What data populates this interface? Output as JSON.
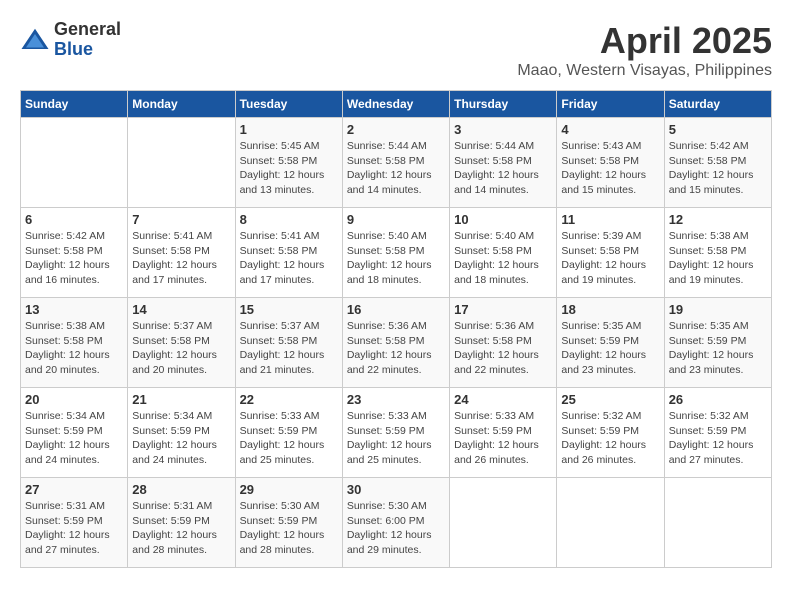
{
  "logo": {
    "general": "General",
    "blue": "Blue"
  },
  "title": "April 2025",
  "subtitle": "Maao, Western Visayas, Philippines",
  "days_of_week": [
    "Sunday",
    "Monday",
    "Tuesday",
    "Wednesday",
    "Thursday",
    "Friday",
    "Saturday"
  ],
  "weeks": [
    [
      {
        "day": "",
        "info": ""
      },
      {
        "day": "",
        "info": ""
      },
      {
        "day": "1",
        "info": "Sunrise: 5:45 AM\nSunset: 5:58 PM\nDaylight: 12 hours\nand 13 minutes."
      },
      {
        "day": "2",
        "info": "Sunrise: 5:44 AM\nSunset: 5:58 PM\nDaylight: 12 hours\nand 14 minutes."
      },
      {
        "day": "3",
        "info": "Sunrise: 5:44 AM\nSunset: 5:58 PM\nDaylight: 12 hours\nand 14 minutes."
      },
      {
        "day": "4",
        "info": "Sunrise: 5:43 AM\nSunset: 5:58 PM\nDaylight: 12 hours\nand 15 minutes."
      },
      {
        "day": "5",
        "info": "Sunrise: 5:42 AM\nSunset: 5:58 PM\nDaylight: 12 hours\nand 15 minutes."
      }
    ],
    [
      {
        "day": "6",
        "info": "Sunrise: 5:42 AM\nSunset: 5:58 PM\nDaylight: 12 hours\nand 16 minutes."
      },
      {
        "day": "7",
        "info": "Sunrise: 5:41 AM\nSunset: 5:58 PM\nDaylight: 12 hours\nand 17 minutes."
      },
      {
        "day": "8",
        "info": "Sunrise: 5:41 AM\nSunset: 5:58 PM\nDaylight: 12 hours\nand 17 minutes."
      },
      {
        "day": "9",
        "info": "Sunrise: 5:40 AM\nSunset: 5:58 PM\nDaylight: 12 hours\nand 18 minutes."
      },
      {
        "day": "10",
        "info": "Sunrise: 5:40 AM\nSunset: 5:58 PM\nDaylight: 12 hours\nand 18 minutes."
      },
      {
        "day": "11",
        "info": "Sunrise: 5:39 AM\nSunset: 5:58 PM\nDaylight: 12 hours\nand 19 minutes."
      },
      {
        "day": "12",
        "info": "Sunrise: 5:38 AM\nSunset: 5:58 PM\nDaylight: 12 hours\nand 19 minutes."
      }
    ],
    [
      {
        "day": "13",
        "info": "Sunrise: 5:38 AM\nSunset: 5:58 PM\nDaylight: 12 hours\nand 20 minutes."
      },
      {
        "day": "14",
        "info": "Sunrise: 5:37 AM\nSunset: 5:58 PM\nDaylight: 12 hours\nand 20 minutes."
      },
      {
        "day": "15",
        "info": "Sunrise: 5:37 AM\nSunset: 5:58 PM\nDaylight: 12 hours\nand 21 minutes."
      },
      {
        "day": "16",
        "info": "Sunrise: 5:36 AM\nSunset: 5:58 PM\nDaylight: 12 hours\nand 22 minutes."
      },
      {
        "day": "17",
        "info": "Sunrise: 5:36 AM\nSunset: 5:58 PM\nDaylight: 12 hours\nand 22 minutes."
      },
      {
        "day": "18",
        "info": "Sunrise: 5:35 AM\nSunset: 5:59 PM\nDaylight: 12 hours\nand 23 minutes."
      },
      {
        "day": "19",
        "info": "Sunrise: 5:35 AM\nSunset: 5:59 PM\nDaylight: 12 hours\nand 23 minutes."
      }
    ],
    [
      {
        "day": "20",
        "info": "Sunrise: 5:34 AM\nSunset: 5:59 PM\nDaylight: 12 hours\nand 24 minutes."
      },
      {
        "day": "21",
        "info": "Sunrise: 5:34 AM\nSunset: 5:59 PM\nDaylight: 12 hours\nand 24 minutes."
      },
      {
        "day": "22",
        "info": "Sunrise: 5:33 AM\nSunset: 5:59 PM\nDaylight: 12 hours\nand 25 minutes."
      },
      {
        "day": "23",
        "info": "Sunrise: 5:33 AM\nSunset: 5:59 PM\nDaylight: 12 hours\nand 25 minutes."
      },
      {
        "day": "24",
        "info": "Sunrise: 5:33 AM\nSunset: 5:59 PM\nDaylight: 12 hours\nand 26 minutes."
      },
      {
        "day": "25",
        "info": "Sunrise: 5:32 AM\nSunset: 5:59 PM\nDaylight: 12 hours\nand 26 minutes."
      },
      {
        "day": "26",
        "info": "Sunrise: 5:32 AM\nSunset: 5:59 PM\nDaylight: 12 hours\nand 27 minutes."
      }
    ],
    [
      {
        "day": "27",
        "info": "Sunrise: 5:31 AM\nSunset: 5:59 PM\nDaylight: 12 hours\nand 27 minutes."
      },
      {
        "day": "28",
        "info": "Sunrise: 5:31 AM\nSunset: 5:59 PM\nDaylight: 12 hours\nand 28 minutes."
      },
      {
        "day": "29",
        "info": "Sunrise: 5:30 AM\nSunset: 5:59 PM\nDaylight: 12 hours\nand 28 minutes."
      },
      {
        "day": "30",
        "info": "Sunrise: 5:30 AM\nSunset: 6:00 PM\nDaylight: 12 hours\nand 29 minutes."
      },
      {
        "day": "",
        "info": ""
      },
      {
        "day": "",
        "info": ""
      },
      {
        "day": "",
        "info": ""
      }
    ]
  ]
}
